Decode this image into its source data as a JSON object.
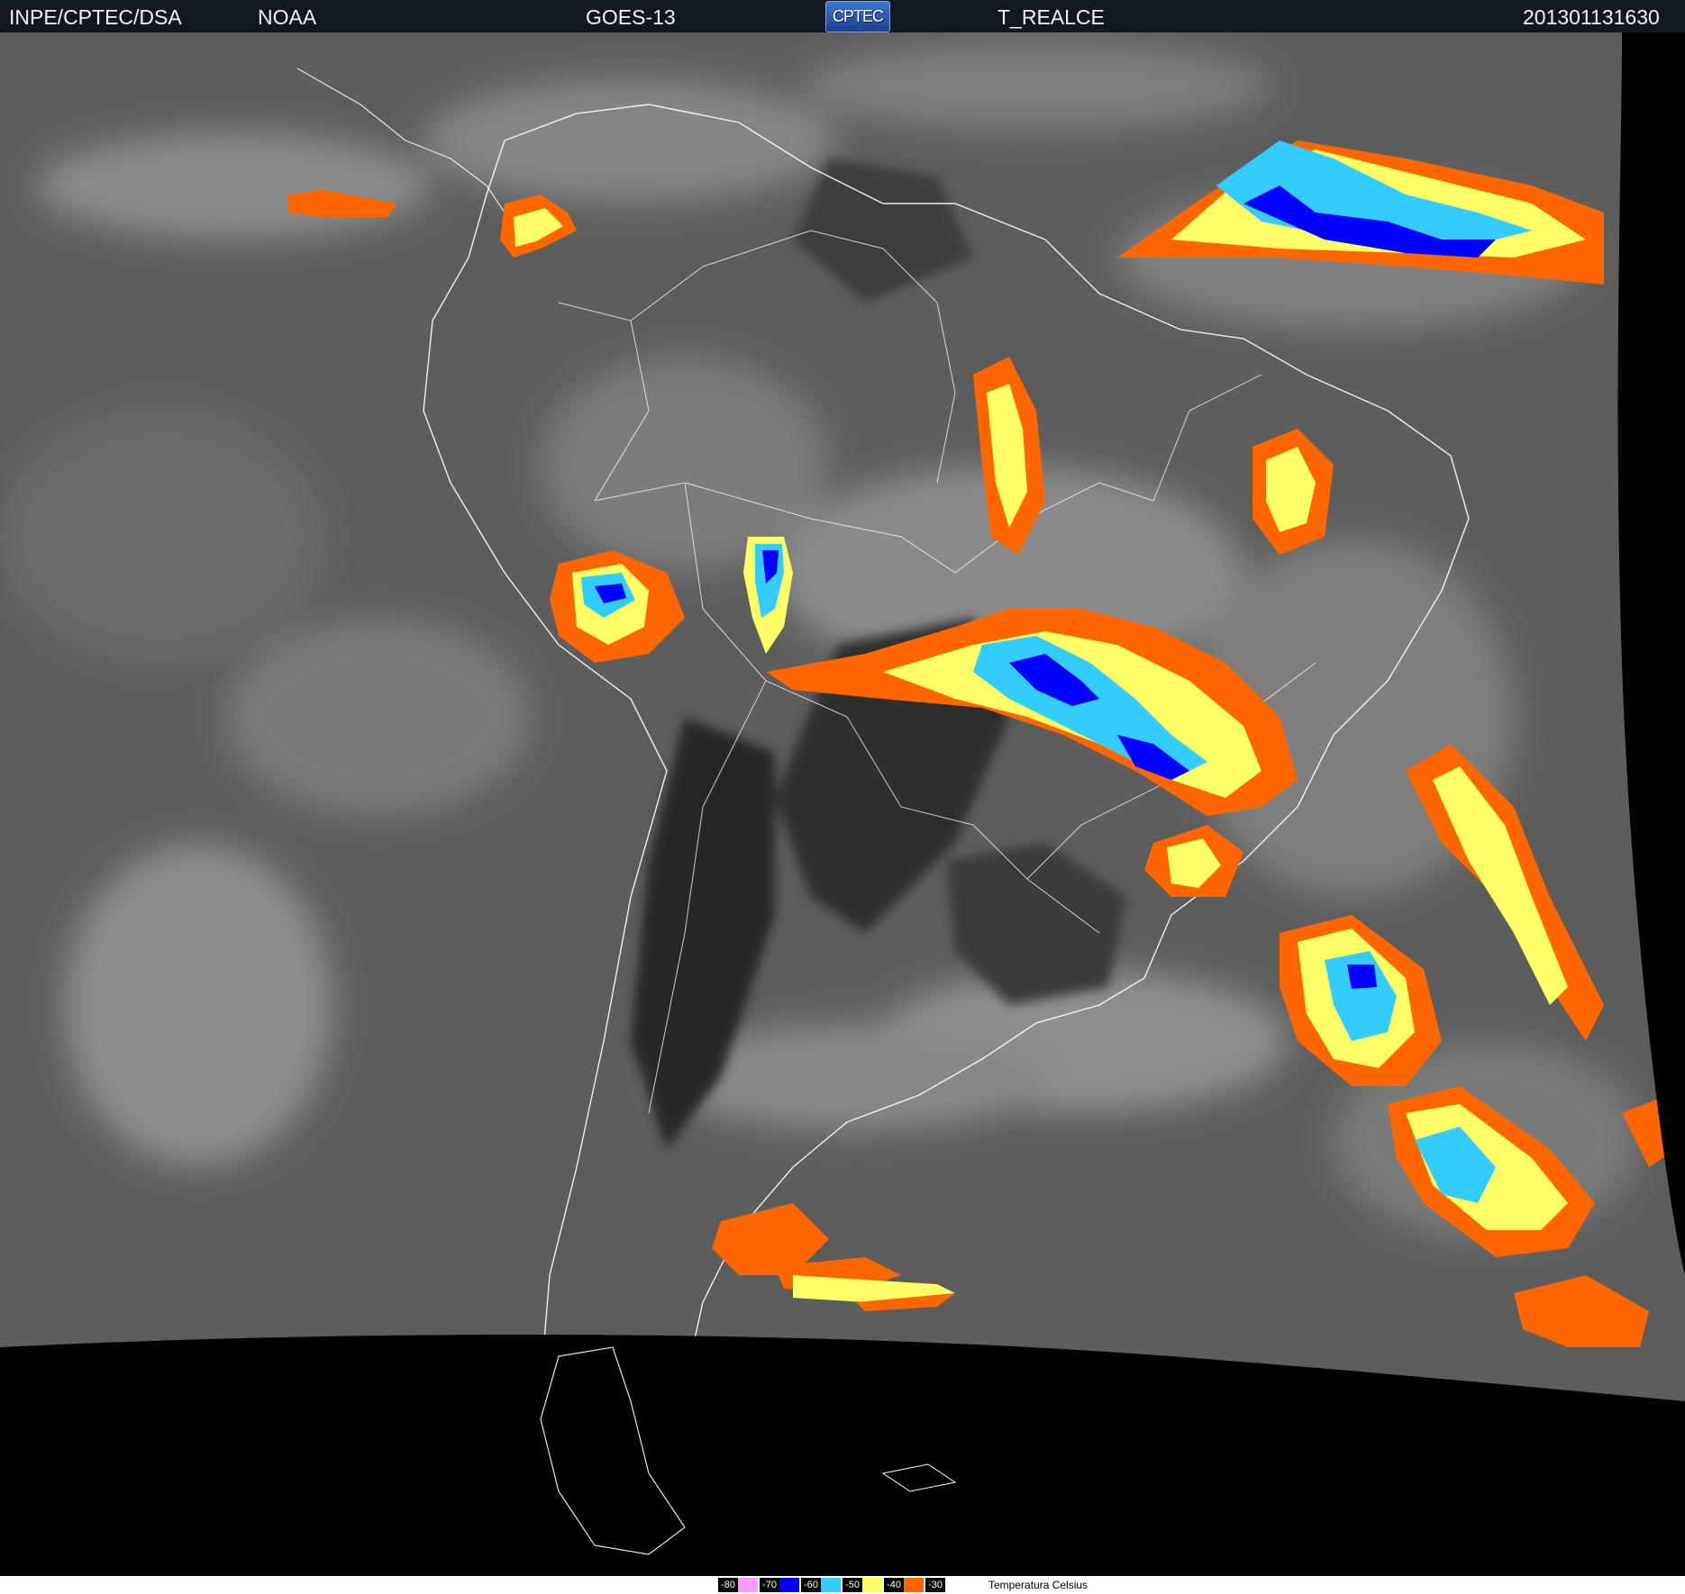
{
  "header": {
    "agency": "INPE/CPTEC/DSA",
    "source": "NOAA",
    "satellite": "GOES-13",
    "logo_text": "CPTEC",
    "product": "T_REALCE",
    "timestamp": "201301131630"
  },
  "legend": {
    "label": "Temperatura   Celsius",
    "colors": [
      "#ff99ff",
      "#0000ff",
      "#33ccff",
      "#ffff66",
      "#ff6600"
    ],
    "items": [
      {
        "value": "-80",
        "color": "#ff99ff"
      },
      {
        "value": "-70",
        "color": "#0000ff"
      },
      {
        "value": "-60",
        "color": "#33ccff"
      },
      {
        "value": "-50",
        "color": "#ffff66"
      },
      {
        "value": "-40",
        "color": "#ff6600"
      },
      {
        "value": "-30",
        "color": ""
      }
    ]
  }
}
